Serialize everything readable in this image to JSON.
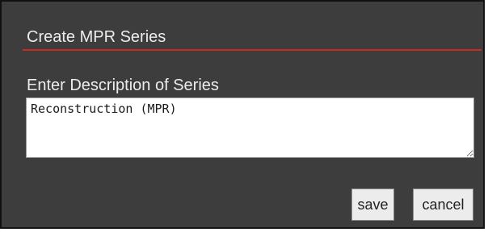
{
  "dialog": {
    "title": "Create MPR Series",
    "accent_color": "#cc2a1f",
    "background_color": "#3d3d3d",
    "description_label": "Enter Description of Series",
    "description_value": "Reconstruction (MPR)",
    "buttons": {
      "save_label": "save",
      "cancel_label": "cancel"
    }
  }
}
